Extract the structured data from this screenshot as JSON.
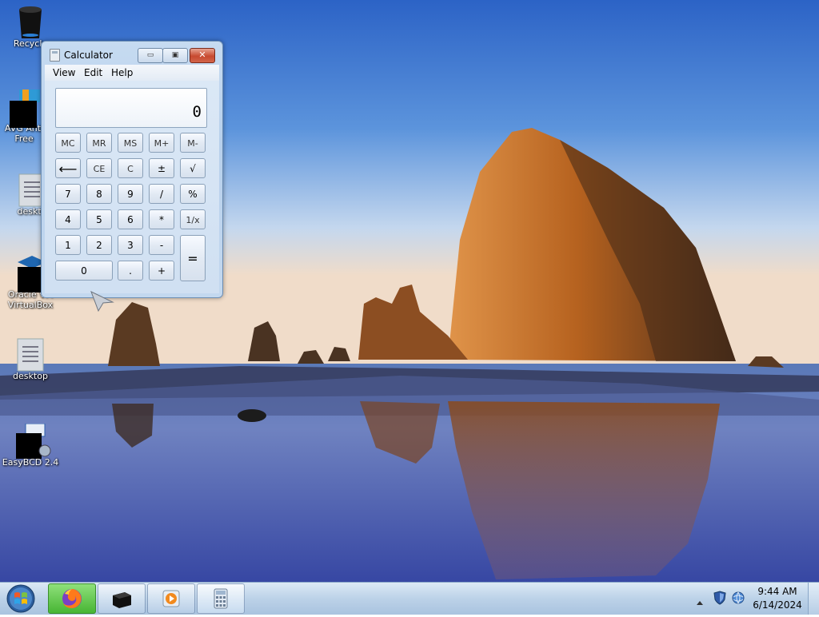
{
  "desktop": {
    "icons": [
      {
        "label": "Recycle",
        "icon": "recycle-bin-icon"
      },
      {
        "label": "AVG Anti Free",
        "icon": "avg-antivirus-icon"
      },
      {
        "label": "deskto",
        "icon": "text-file-icon"
      },
      {
        "label": "Oracle VM VirtualBox",
        "icon": "virtualbox-icon"
      },
      {
        "label": "desktop",
        "icon": "text-file-icon"
      },
      {
        "label": "EasyBCD 2.4",
        "icon": "easybcd-icon"
      }
    ]
  },
  "calculator": {
    "title": "Calculator",
    "window_buttons": {
      "minimize": "▭",
      "maximize": "▣",
      "close": "✕"
    },
    "menu": [
      "View",
      "Edit",
      "Help"
    ],
    "display": "0",
    "keys": {
      "mc": "MC",
      "mr": "MR",
      "ms": "MS",
      "mplus": "M+",
      "mminus": "M-",
      "back": "⟵",
      "ce": "CE",
      "c": "C",
      "plusminus": "±",
      "sqrt": "√",
      "k7": "7",
      "k8": "8",
      "k9": "9",
      "div": "/",
      "pct": "%",
      "k4": "4",
      "k5": "5",
      "k6": "6",
      "mul": "*",
      "recip": "1/x",
      "k1": "1",
      "k2": "2",
      "k3": "3",
      "sub": "-",
      "eq": "=",
      "k0": "0",
      "dot": ".",
      "add": "+"
    }
  },
  "taskbar": {
    "apps": [
      "firefox-icon",
      "terminal-icon",
      "media-player-icon",
      "calculator-icon"
    ],
    "clock": {
      "time": "9:44 AM",
      "date": "6/14/2024"
    }
  },
  "colors": {
    "sky_top": "#2f67c8",
    "sky_horizon": "#eed9c8",
    "rock": "#b05d20",
    "sea": "#3e4ea6",
    "taskbar": "#bcd2e8",
    "close_button": "#c74a30"
  }
}
